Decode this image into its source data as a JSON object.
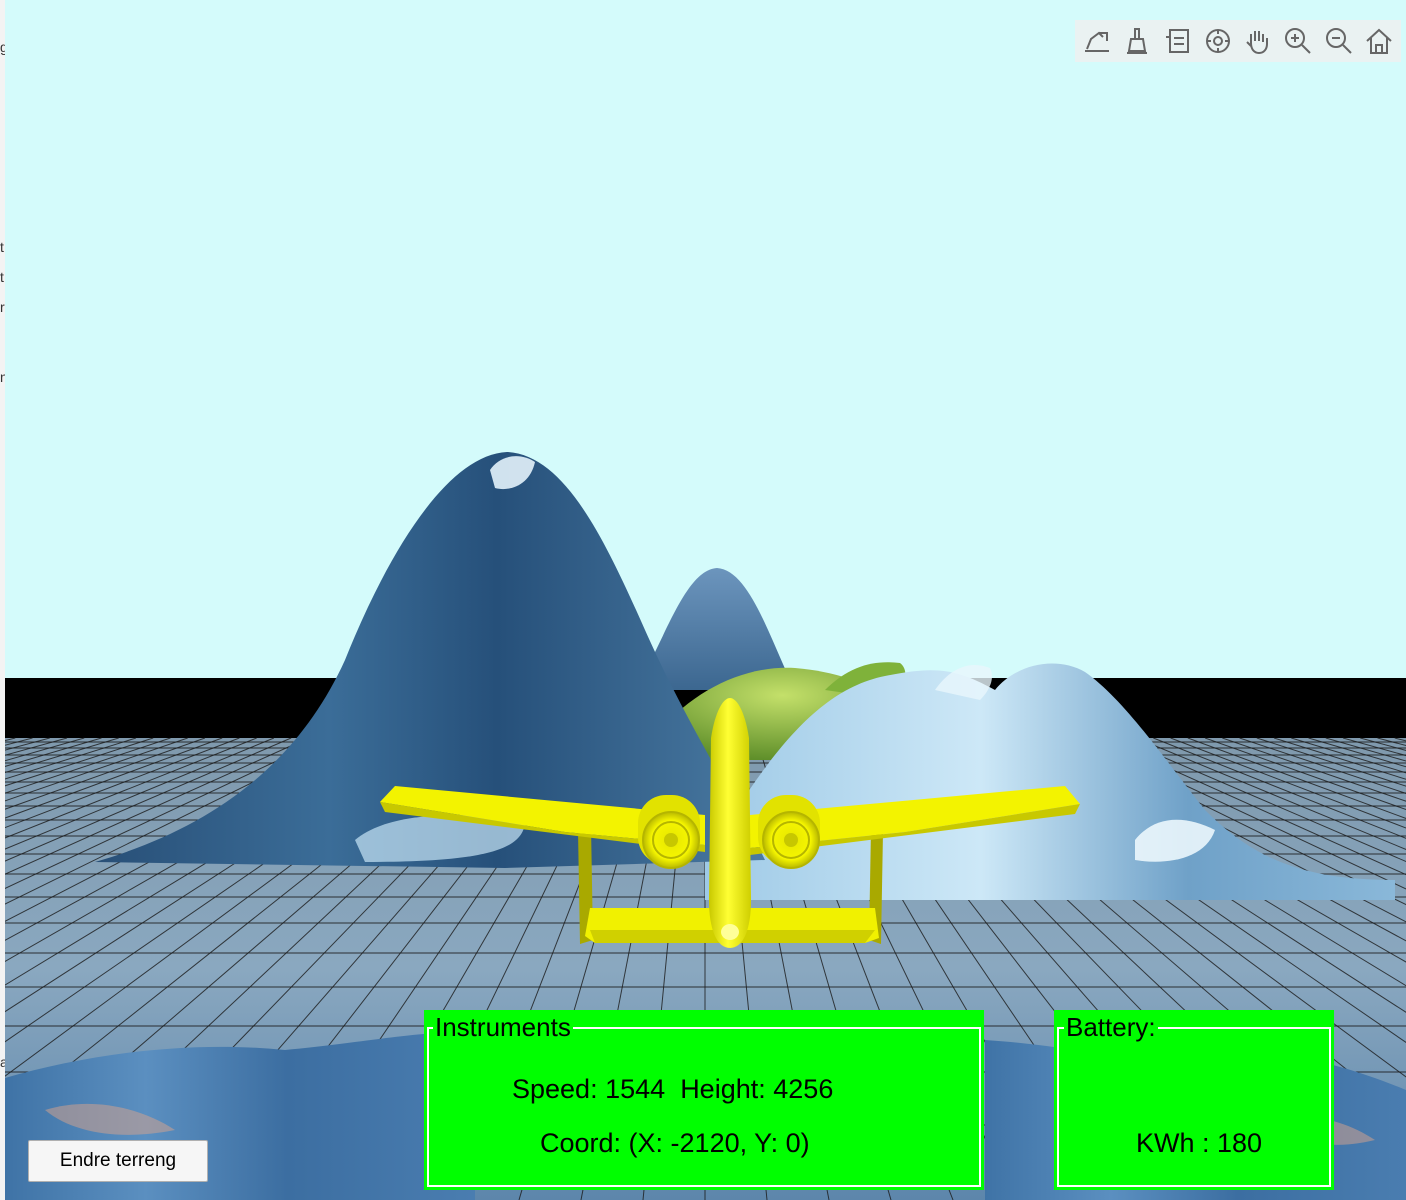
{
  "toolbar": {
    "icons": [
      "export-icon",
      "brush-icon",
      "datatip-icon",
      "rotate-3d-icon",
      "pan-hand-icon",
      "zoom-in-icon",
      "zoom-out-icon",
      "home-icon"
    ]
  },
  "instruments": {
    "title": "Instruments",
    "speed_label": "Speed:",
    "speed_value": "1544",
    "height_label": "Height:",
    "height_value": "4256",
    "coord_text": "Coord: (X: -2120, Y: 0)"
  },
  "battery": {
    "title": "Battery:",
    "kwh_text": "KWh : 180"
  },
  "controls": {
    "endre_label": "Endre terreng"
  },
  "colors": {
    "sky": "#d4fbfb",
    "panel": "#00ff00",
    "aircraft": "#f3f300",
    "terrain": "#2f5f86"
  }
}
